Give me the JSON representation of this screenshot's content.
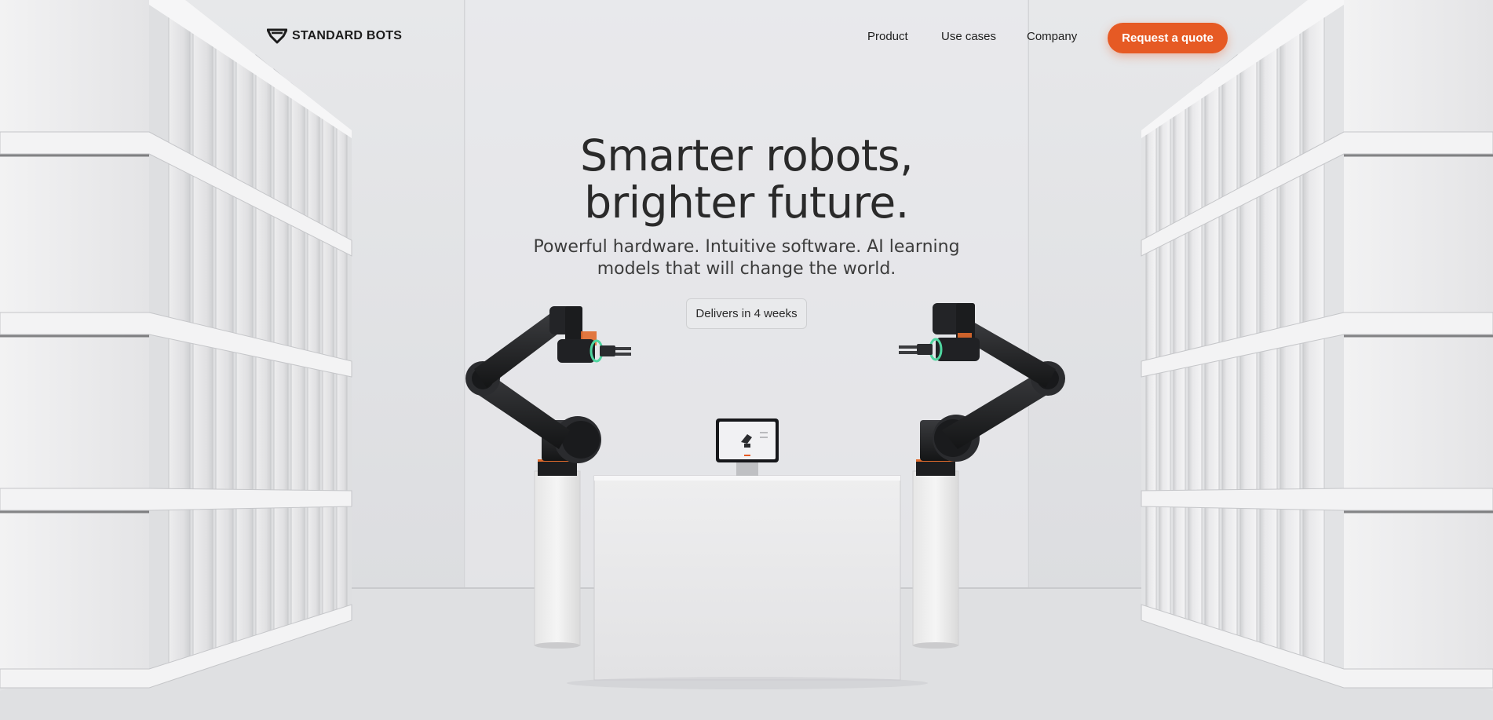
{
  "brand": {
    "name": "STANDARD BOTS",
    "logo_icon": "standard-bots-logo-icon"
  },
  "nav": {
    "items": [
      {
        "label": "Product"
      },
      {
        "label": "Use cases"
      },
      {
        "label": "Company"
      }
    ],
    "cta_label": "Request a quote"
  },
  "hero": {
    "title_lines": [
      "Smarter robots,",
      "brighter future."
    ],
    "subtitle_lines": [
      "Powerful hardware. Intuitive software. AI learning",
      "models that will change the world."
    ],
    "badge": "Delivers in 4 weeks"
  },
  "colors": {
    "accent": "#e65a24",
    "background": "#e4e5e7",
    "robot_arm": "#1e1f21",
    "robot_ring": "#4fd6a0",
    "robot_orange": "#e06a2c"
  },
  "scene": {
    "objects": [
      {
        "name": "left-robot-arm",
        "icon": "robot-arm-icon"
      },
      {
        "name": "right-robot-arm",
        "icon": "robot-arm-icon"
      },
      {
        "name": "tablet-display",
        "icon": "tablet-icon"
      },
      {
        "name": "left-storage-rack"
      },
      {
        "name": "right-storage-rack"
      }
    ]
  }
}
